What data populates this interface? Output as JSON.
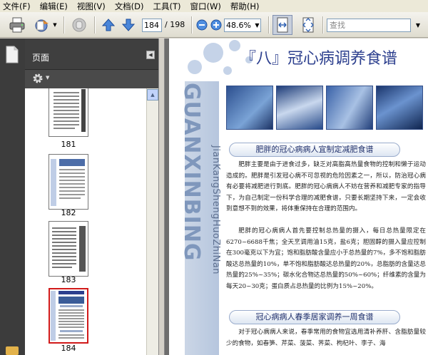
{
  "menu": [
    "文件(F)",
    "编辑(E)",
    "视图(V)",
    "文档(D)",
    "工具(T)",
    "窗口(W)",
    "帮助(H)"
  ],
  "toolbar": {
    "page_current": "184",
    "page_total": "/ 198",
    "zoom": "48.6%",
    "search_placeholder": "查找"
  },
  "panel": {
    "title": "页面",
    "thumbnails": [
      {
        "label": "181"
      },
      {
        "label": "182"
      },
      {
        "label": "183"
      },
      {
        "label": "184",
        "selected": true
      }
    ]
  },
  "document": {
    "title": "『八』冠心病调养食谱",
    "side_text_big": "GUANXINBING",
    "side_text_small": "JianKangShengHuoZhiNan",
    "banner1": "肥胖的冠心病病人宜制定减肥食谱",
    "para1": "肥胖主要是由于进食过多，缺乏对高脂高热量食物的控制和懒于运动造成的。肥胖是引发冠心病不可忽视的危险因素之一，所以，防治冠心病有必要将减肥进行到底。肥胖的冠心病病人不妨在营养和减肥专家的指导下，为自己制定一份科学合理的减肥食谱，只要长期坚持下来，一定会收到意想不到的效果，将体重保持在合理的范围内。",
    "para2": "肥胖的冠心病病人首先要控制总热量的摄入，每日总热量限定在6270~6688千焦；全天烹调用油15克，盐6克；胆固醇的摄入量应控制在300毫克以下为宜；饱和脂肪酸含量应小于总热量的7%，多不饱和脂肪酸达总热量的10%，单不饱和脂肪酸达总热量的20%，总脂肪的含量达总热量的25%~35%；碳水化合物达总热量的50%~60%；纤维素的含量为每天20~30克；蛋白质占总热量的比例为15%~20%。",
    "banner2": "冠心病病人春季居家调养一周食谱",
    "para3": "对于冠心病病人来说，春季常用的食物宜选用清补养肝、含脂肪量较少的食物，如春笋、芹菜、菠菜、荠菜、枸杞叶、李子、海"
  },
  "colors": {
    "title_blue": "#2c3f8e",
    "side_band": "#b6c6de",
    "selected_thumb": "#d11a1a"
  }
}
